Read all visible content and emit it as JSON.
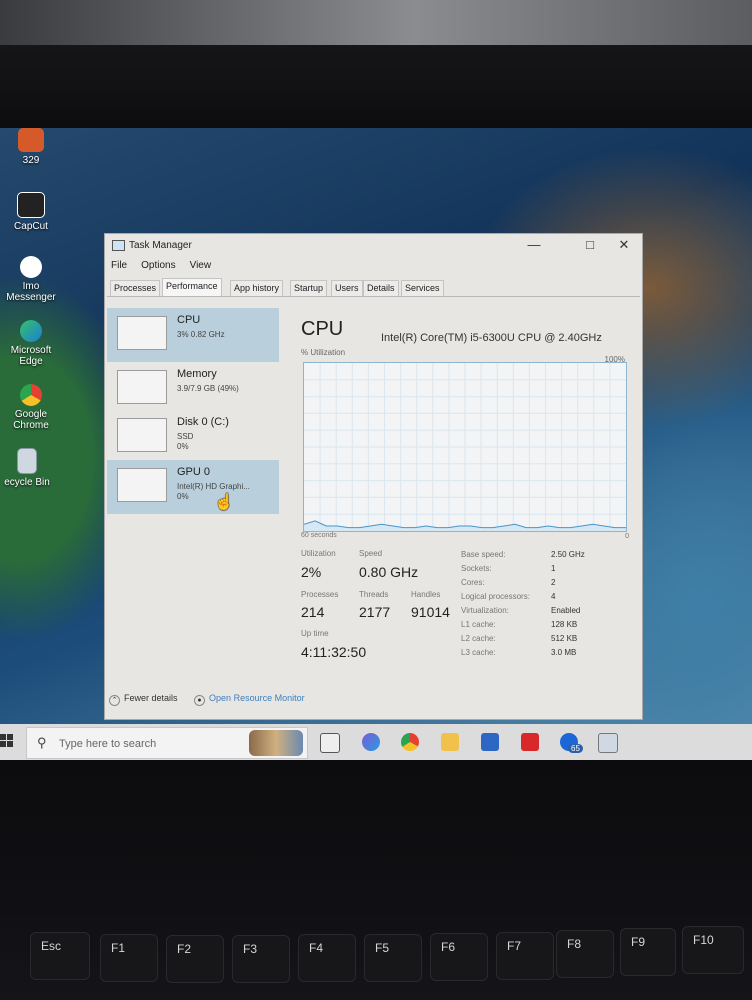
{
  "desktop": {
    "icons": [
      {
        "label": "329",
        "icon": "pdf-file-icon"
      },
      {
        "label": "CapCut",
        "icon": "capcut-icon"
      },
      {
        "label": "Imo Messenger",
        "icon": "imo-icon"
      },
      {
        "label": "Microsoft Edge",
        "icon": "edge-icon"
      },
      {
        "label": "Google Chrome",
        "icon": "chrome-icon"
      },
      {
        "label": "ecycle Bin",
        "icon": "recycle-bin-icon"
      }
    ]
  },
  "window": {
    "title": "Task Manager",
    "menu": [
      "File",
      "Options",
      "View"
    ],
    "tabs": [
      "Processes",
      "Performance",
      "App history",
      "Startup",
      "Users",
      "Details",
      "Services"
    ],
    "active_tab": "Performance"
  },
  "sidebar": [
    {
      "name": "CPU",
      "line1": "3% 0.82 GHz",
      "line2": "",
      "selected": true
    },
    {
      "name": "Memory",
      "line1": "3.9/7.9 GB (49%)",
      "line2": "",
      "selected": false
    },
    {
      "name": "Disk 0 (C:)",
      "line1": "SSD",
      "line2": "0%",
      "selected": false
    },
    {
      "name": "GPU 0",
      "line1": "Intel(R) HD Graphi...",
      "line2": "0%",
      "selected": false
    }
  ],
  "main": {
    "title": "CPU",
    "model": "Intel(R) Core(TM) i5-6300U CPU @ 2.40GHz",
    "util_label": "% Utilization",
    "util_max": "100%",
    "time_label": "60 seconds",
    "zero_label": "0",
    "stats": {
      "utilization": {
        "label": "Utilization",
        "value": "2%"
      },
      "speed": {
        "label": "Speed",
        "value": "0.80 GHz"
      },
      "processes": {
        "label": "Processes",
        "value": "214"
      },
      "threads": {
        "label": "Threads",
        "value": "2177"
      },
      "handles": {
        "label": "Handles",
        "value": "91014"
      },
      "uptime": {
        "label": "Up time",
        "value": "4:11:32:50"
      }
    },
    "right_stats": [
      {
        "label": "Base speed:",
        "value": "2.50 GHz"
      },
      {
        "label": "Sockets:",
        "value": "1"
      },
      {
        "label": "Cores:",
        "value": "2"
      },
      {
        "label": "Logical processors:",
        "value": "4"
      },
      {
        "label": "Virtualization:",
        "value": "Enabled"
      },
      {
        "label": "L1 cache:",
        "value": "128 KB"
      },
      {
        "label": "L2 cache:",
        "value": "512 KB"
      },
      {
        "label": "L3 cache:",
        "value": "3.0 MB"
      }
    ]
  },
  "chart_data": {
    "type": "area",
    "y": [
      4,
      6,
      3,
      3,
      2,
      2,
      3,
      4,
      3,
      2,
      2,
      3,
      2,
      2,
      3,
      3,
      2,
      2,
      3,
      4,
      2,
      2,
      3,
      2,
      2,
      3,
      4,
      3,
      2,
      2
    ],
    "ylim": [
      0,
      100
    ]
  },
  "footer": {
    "fewer_details": "Fewer details",
    "open_monitor": "Open Resource Monitor"
  },
  "taskbar": {
    "search_placeholder": "Type here to search",
    "apps": [
      "task-view-icon",
      "teams-icon",
      "chrome-icon",
      "file-explorer-icon",
      "store-icon",
      "app-icon",
      "facebook-icon",
      "task-manager-icon"
    ],
    "badge": "65"
  },
  "keyboard": {
    "keys": [
      "Esc",
      "F1",
      "F2",
      "F3",
      "F4",
      "F5",
      "F6",
      "F7",
      "F8",
      "F9",
      "F10"
    ]
  }
}
